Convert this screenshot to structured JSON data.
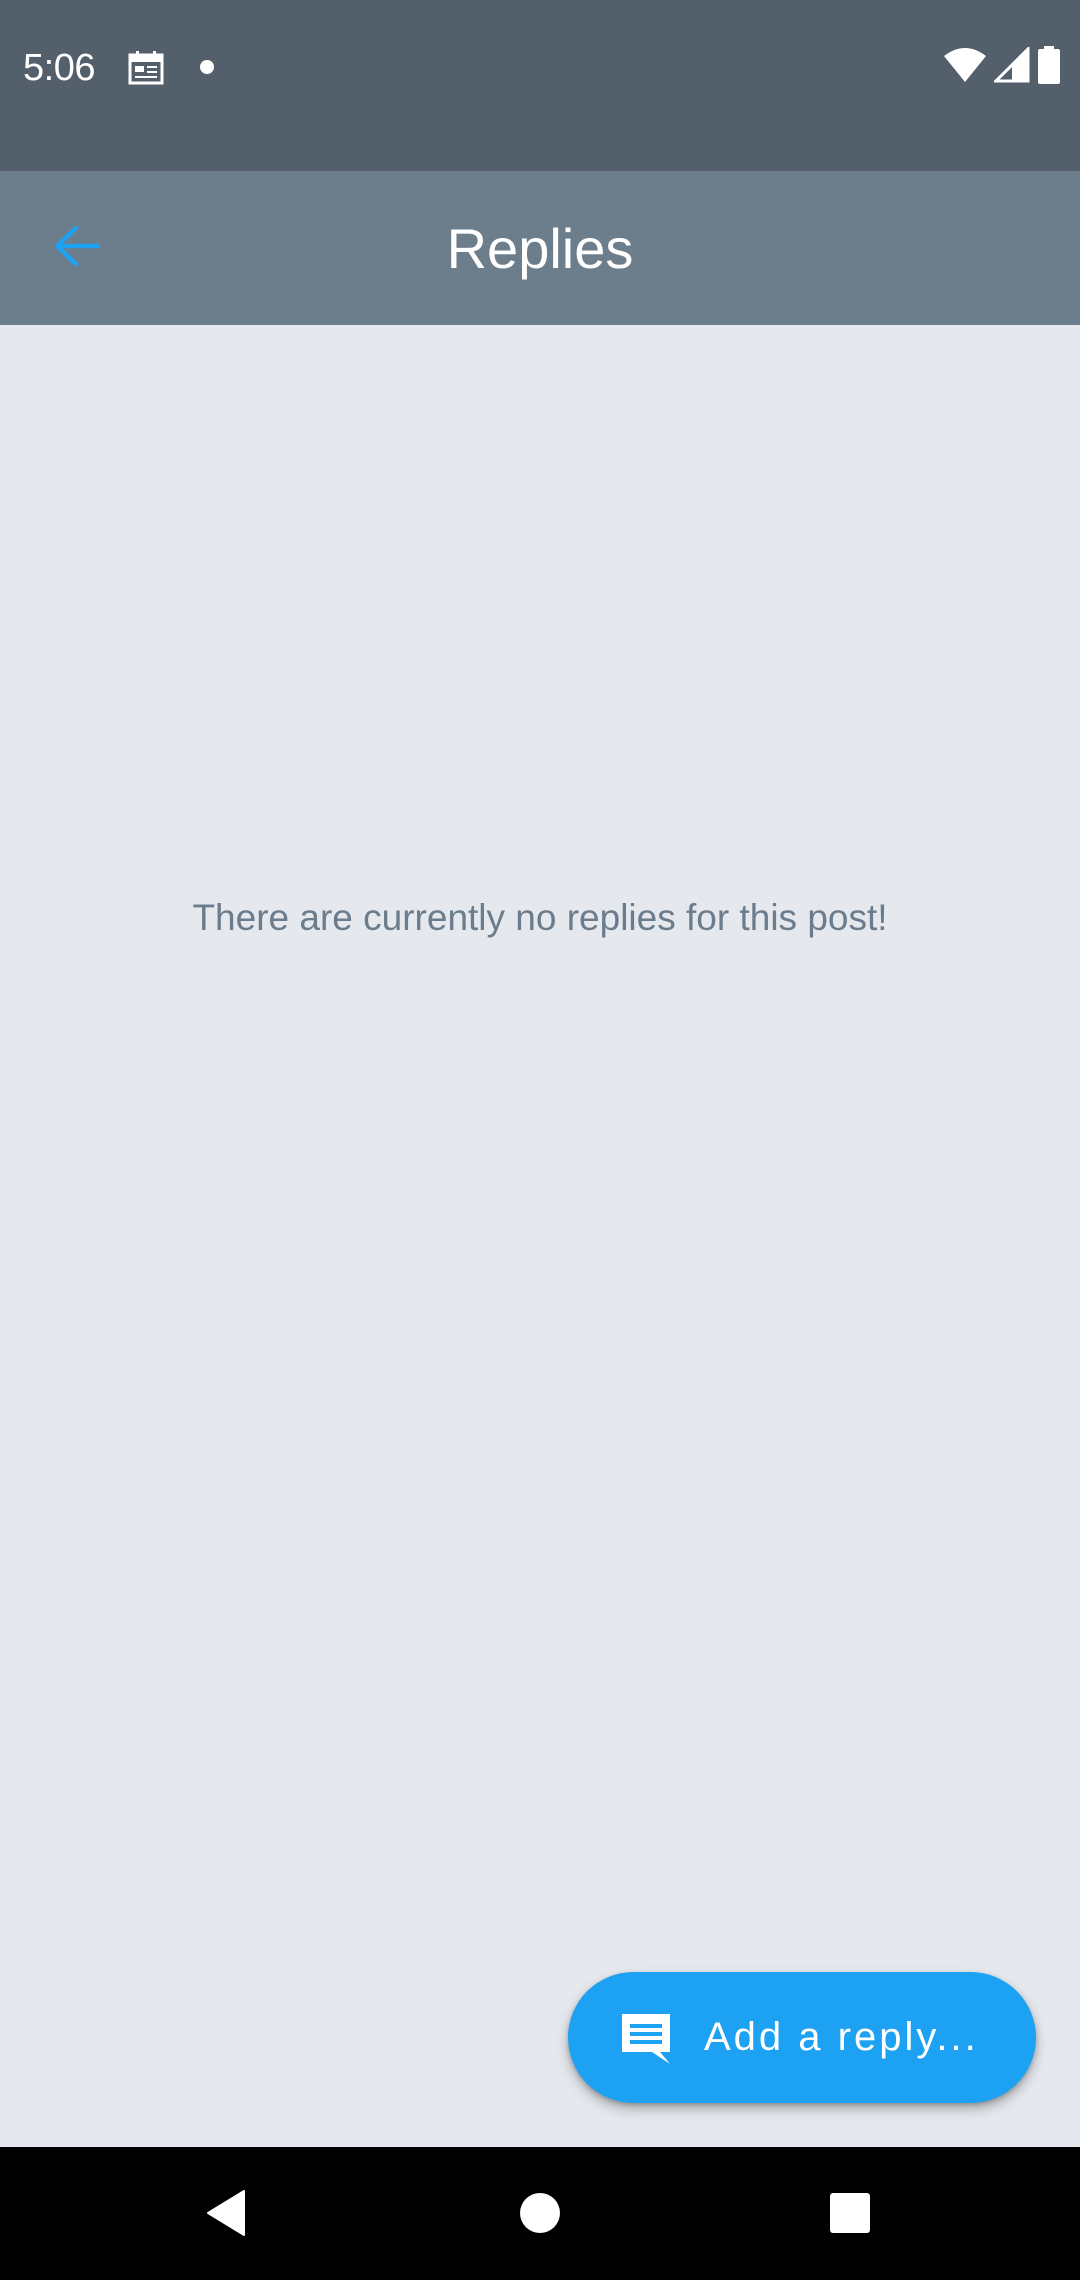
{
  "status_bar": {
    "time": "5:06",
    "icons": [
      "calendar-icon",
      "notification-dot-icon",
      "wifi-icon",
      "cell-signal-icon",
      "battery-icon"
    ]
  },
  "app_bar": {
    "title": "Replies",
    "back_icon": "arrow-left-icon"
  },
  "content": {
    "empty_message": "There are currently no replies for this post!"
  },
  "fab": {
    "label": "Add a reply...",
    "icon": "comment-icon"
  },
  "nav_bar": {
    "icons": [
      "back-triangle-icon",
      "home-circle-icon",
      "recents-square-icon"
    ]
  },
  "colors": {
    "status_bar": "#535f6b",
    "app_bar": "#6c7e8c",
    "background": "#e5e9ee",
    "accent": "#1da1f2",
    "muted_text": "#6b7c8c",
    "nav_bar": "#000000"
  }
}
